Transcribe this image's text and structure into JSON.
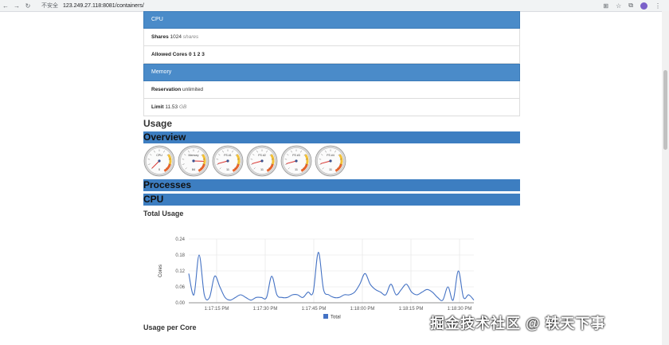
{
  "browser": {
    "insecure_label": "不安全",
    "url": "123.249.27.118:8081/containers/"
  },
  "cpu_panel": {
    "title": "CPU",
    "shares_label": "Shares",
    "shares_value": "1024",
    "shares_unit": "shares",
    "cores_label": "Allowed Cores",
    "cores_value": "0 1 2 3"
  },
  "memory_panel": {
    "title": "Memory",
    "reservation_label": "Reservation",
    "reservation_value": "unlimited",
    "limit_label": "Limit",
    "limit_value": "11.53",
    "limit_unit": "GB"
  },
  "headings": {
    "usage": "Usage",
    "overview": "Overview",
    "processes": "Processes",
    "cpu": "CPU",
    "total_usage": "Total Usage",
    "usage_per_core": "Usage per Core"
  },
  "gauges": [
    {
      "label": "CPU",
      "value": "0",
      "needle": 0.0
    },
    {
      "label": "Memory",
      "value": "84",
      "needle": 0.84
    },
    {
      "label": "FS #1",
      "value": "11",
      "needle": 0.11
    },
    {
      "label": "FS #2",
      "value": "11",
      "needle": 0.11
    },
    {
      "label": "FS #3",
      "value": "11",
      "needle": 0.11
    },
    {
      "label": "FS #4",
      "value": "11",
      "needle": 0.11
    }
  ],
  "chart_data": {
    "type": "line",
    "ylabel": "Cores",
    "ylim": [
      0,
      0.24
    ],
    "yticks": [
      "0.00",
      "0.06",
      "0.12",
      "0.18",
      "0.24"
    ],
    "xticks": [
      "1:17:15 PM",
      "1:17:30 PM",
      "1:17:45 PM",
      "1:18:00 PM",
      "1:18:15 PM",
      "1:18:30 PM"
    ],
    "legend": "Total",
    "color": "#4472c4",
    "values": [
      0.11,
      0.03,
      0.18,
      0.03,
      0.02,
      0.1,
      0.06,
      0.02,
      0.01,
      0.02,
      0.03,
      0.02,
      0.01,
      0.02,
      0.02,
      0.02,
      0.1,
      0.03,
      0.02,
      0.02,
      0.03,
      0.03,
      0.02,
      0.04,
      0.04,
      0.19,
      0.05,
      0.03,
      0.02,
      0.02,
      0.03,
      0.03,
      0.04,
      0.07,
      0.11,
      0.07,
      0.05,
      0.04,
      0.03,
      0.07,
      0.03,
      0.05,
      0.07,
      0.04,
      0.03,
      0.04,
      0.05,
      0.04,
      0.02,
      0.01,
      0.06,
      0.01,
      0.12,
      0.02,
      0.03,
      0.01
    ]
  },
  "watermark": "掘金技术社区 @ 轶天下事"
}
